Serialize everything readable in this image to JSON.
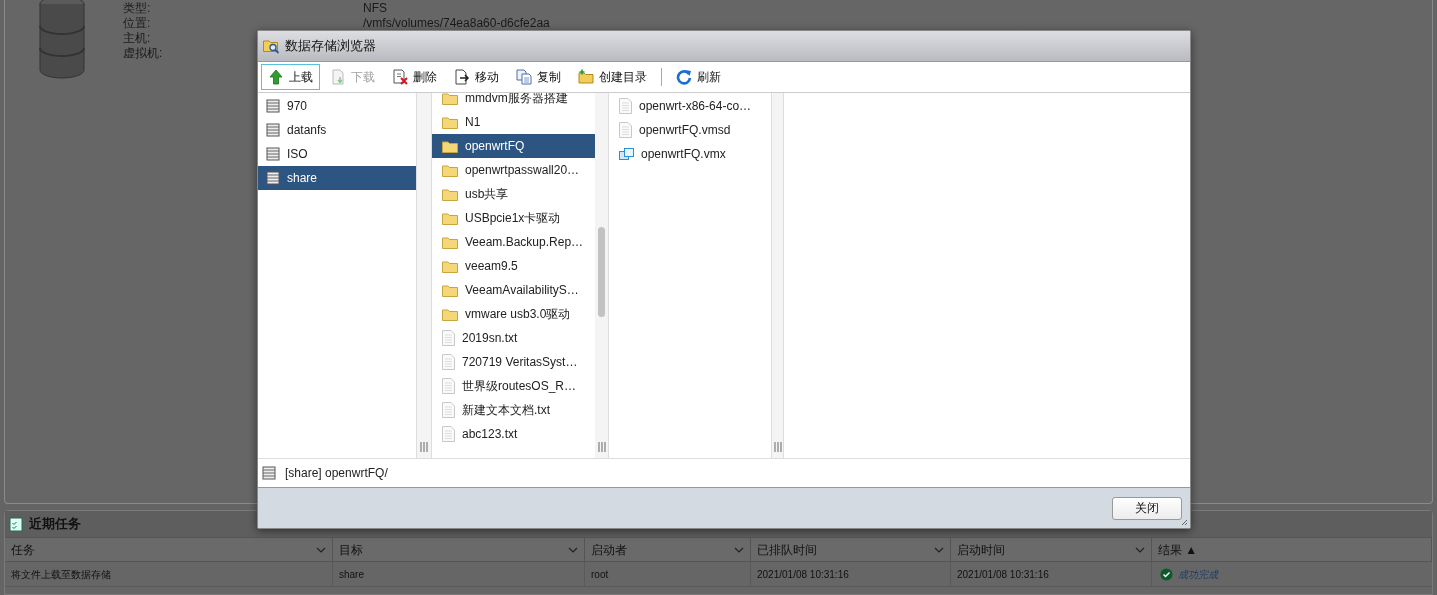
{
  "background": {
    "properties": [
      {
        "label": "类型:",
        "value": "NFS"
      },
      {
        "label": "位置:",
        "value": "/vmfs/volumes/74ea8a60-d6cfe2aa"
      },
      {
        "label": "主机:"
      },
      {
        "label": "虚拟机:"
      }
    ]
  },
  "dialog": {
    "title": "数据存储浏览器",
    "toolbar": [
      {
        "kind": "upload",
        "label": "上载",
        "focused": true,
        "disabled": false
      },
      {
        "kind": "download",
        "label": "下载",
        "focused": false,
        "disabled": true
      },
      {
        "kind": "delete",
        "label": "删除",
        "focused": false,
        "disabled": false
      },
      {
        "kind": "move",
        "label": "移动",
        "focused": false,
        "disabled": false
      },
      {
        "kind": "copy",
        "label": "复制",
        "focused": false,
        "disabled": false
      },
      {
        "kind": "newfolder",
        "label": "创建目录",
        "focused": false,
        "disabled": false
      },
      {
        "kind": "separator"
      },
      {
        "kind": "refresh",
        "label": "刷新",
        "focused": false,
        "disabled": false
      }
    ],
    "datastores": [
      {
        "name": "970",
        "selected": false
      },
      {
        "name": "datanfs",
        "selected": false
      },
      {
        "name": "ISO",
        "selected": false
      },
      {
        "name": "share",
        "selected": true
      }
    ],
    "folders": [
      {
        "kind": "folder",
        "name": "mmdvm服务器搭建",
        "selected": false
      },
      {
        "kind": "folder",
        "name": "N1",
        "selected": false
      },
      {
        "kind": "folder",
        "name": "openwrtFQ",
        "selected": true
      },
      {
        "kind": "folder",
        "name": "openwrtpasswall20…",
        "selected": false
      },
      {
        "kind": "folder",
        "name": "usb共享",
        "selected": false
      },
      {
        "kind": "folder",
        "name": "USBpcie1x卡驱动",
        "selected": false
      },
      {
        "kind": "folder",
        "name": "Veeam.Backup.Rep…",
        "selected": false
      },
      {
        "kind": "folder",
        "name": "veeam9.5",
        "selected": false
      },
      {
        "kind": "folder",
        "name": "VeeamAvailabilityS…",
        "selected": false
      },
      {
        "kind": "folder",
        "name": "vmware usb3.0驱动",
        "selected": false
      },
      {
        "kind": "file",
        "name": "2019sn.txt",
        "selected": false
      },
      {
        "kind": "file",
        "name": "720719 VeritasSyst…",
        "selected": false
      },
      {
        "kind": "file",
        "name": "世界级routesOS_R…",
        "selected": false
      },
      {
        "kind": "file",
        "name": "新建文本文档.txt",
        "selected": false
      },
      {
        "kind": "file",
        "name": "abc123.txt",
        "selected": false
      }
    ],
    "files": [
      {
        "kind": "file",
        "name": "openwrt-x86-64-co…",
        "selected": false
      },
      {
        "kind": "file",
        "name": "openwrtFQ.vmsd",
        "selected": false
      },
      {
        "kind": "vmx",
        "name": "openwrtFQ.vmx",
        "selected": false
      }
    ],
    "path": "[share] openwrtFQ/",
    "close_button": "关闭"
  },
  "tasks": {
    "title": "近期任务",
    "columns": [
      {
        "label": "任务"
      },
      {
        "label": "目标"
      },
      {
        "label": "启动者"
      },
      {
        "label": "已排队时间"
      },
      {
        "label": "启动时间"
      },
      {
        "label": "结果",
        "sort": "▲"
      }
    ],
    "rows": [
      {
        "cells": [
          "将文件上载至数据存储",
          "share",
          "root",
          "2021/01/08 10:31:16",
          "2021/01/08 10:31:16"
        ],
        "result": "成功完成"
      }
    ]
  }
}
